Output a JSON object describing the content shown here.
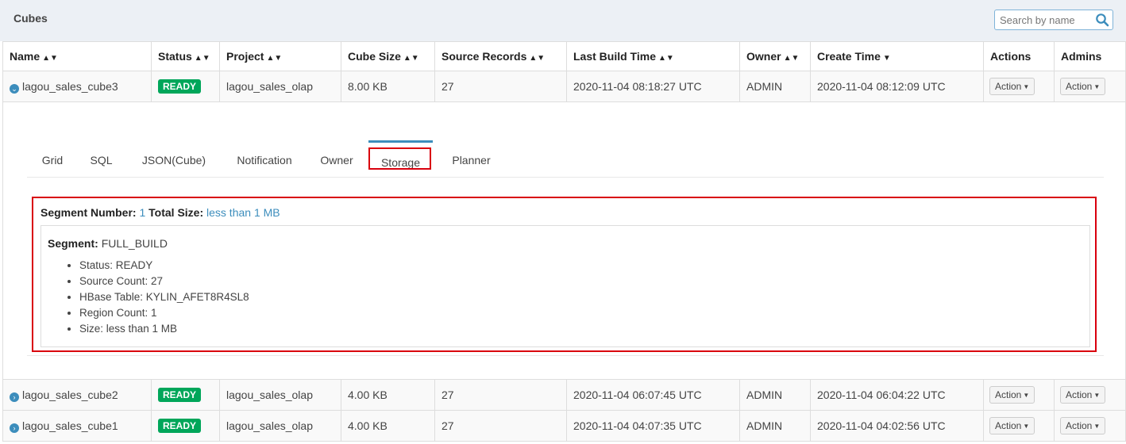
{
  "header": {
    "title": "Cubes",
    "search_placeholder": "Search by name"
  },
  "columns": [
    {
      "label": "Name",
      "sort": "both"
    },
    {
      "label": "Status",
      "sort": "both"
    },
    {
      "label": "Project",
      "sort": "both"
    },
    {
      "label": "Cube Size",
      "sort": "both"
    },
    {
      "label": "Source Records",
      "sort": "both"
    },
    {
      "label": "Last Build Time",
      "sort": "both"
    },
    {
      "label": "Owner",
      "sort": "both"
    },
    {
      "label": "Create Time",
      "sort": "desc"
    },
    {
      "label": "Actions",
      "sort": "none"
    },
    {
      "label": "Admins",
      "sort": "none"
    }
  ],
  "rows": [
    {
      "name": "lagou_sales_cube3",
      "status": "READY",
      "project": "lagou_sales_olap",
      "size": "8.00 KB",
      "records": "27",
      "last_build": "2020-11-04 08:18:27 UTC",
      "owner": "ADMIN",
      "create_time": "2020-11-04 08:12:09 UTC",
      "action": "Action",
      "admin_action": "Action",
      "expanded": true
    },
    {
      "name": "lagou_sales_cube2",
      "status": "READY",
      "project": "lagou_sales_olap",
      "size": "4.00 KB",
      "records": "27",
      "last_build": "2020-11-04 06:07:45 UTC",
      "owner": "ADMIN",
      "create_time": "2020-11-04 06:04:22 UTC",
      "action": "Action",
      "admin_action": "Action",
      "expanded": false
    },
    {
      "name": "lagou_sales_cube1",
      "status": "READY",
      "project": "lagou_sales_olap",
      "size": "4.00 KB",
      "records": "27",
      "last_build": "2020-11-04 04:07:35 UTC",
      "owner": "ADMIN",
      "create_time": "2020-11-04 04:02:56 UTC",
      "action": "Action",
      "admin_action": "Action",
      "expanded": false
    }
  ],
  "detail": {
    "tabs": [
      "Grid",
      "SQL",
      "JSON(Cube)",
      "Notification",
      "Owner",
      "Storage",
      "Planner"
    ],
    "active_tab": "Storage",
    "storage": {
      "segment_number_label": "Segment Number:",
      "segment_number": "1",
      "total_size_label": "Total Size:",
      "total_size": "less than 1 MB",
      "segment_label": "Segment:",
      "segment_name": "FULL_BUILD",
      "items": [
        "Status: READY",
        "Source Count: 27",
        "HBase Table: KYLIN_AFET8R4SL8",
        "Region Count: 1",
        "Size: less than 1 MB"
      ]
    }
  },
  "colors": {
    "accent": "#3c8dbc",
    "ready_badge": "#00a65a",
    "highlight": "#d9000d"
  }
}
